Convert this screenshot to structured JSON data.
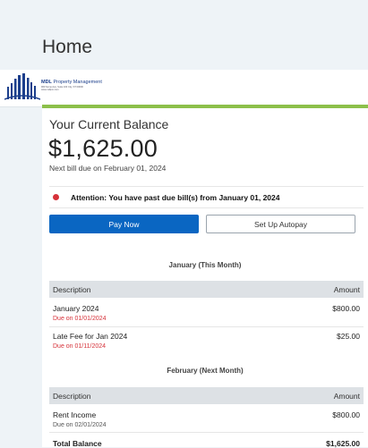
{
  "header": {
    "title": "Home"
  },
  "brand": {
    "name_bold": "MDL",
    "name_rest": " Property Management",
    "address_line1": "960 Some Ave, Suite 100 City, ST 00000",
    "address_line2": "www.mdlpm.com"
  },
  "balance": {
    "heading": "Your Current Balance",
    "amount": "$1,625.00",
    "next_bill": "Next bill due on February 01, 2024"
  },
  "alert": {
    "text": "Attention: You have past due bill(s) from January 01, 2024",
    "color": "#d6323a"
  },
  "actions": {
    "pay_now": "Pay Now",
    "autopay": "Set Up Autopay"
  },
  "table_headers": {
    "description": "Description",
    "amount": "Amount"
  },
  "months": [
    {
      "heading": "January (This Month)",
      "rows": [
        {
          "description": "January 2024",
          "due": "Due on 01/01/2024",
          "amount": "$800.00"
        },
        {
          "description": "Late Fee for Jan 2024",
          "due": "Due on 01/11/2024",
          "amount": "$25.00"
        }
      ]
    },
    {
      "heading": "February (Next Month)",
      "rows": [
        {
          "description": "Rent Income",
          "due": "Due on 02/01/2024",
          "amount": "$800.00"
        }
      ]
    }
  ],
  "total": {
    "label": "Total Balance",
    "amount": "$1,625.00"
  },
  "colors": {
    "accent_bar": "#8cc04a",
    "primary_button": "#0a66c2",
    "past_due": "#d6323a"
  }
}
